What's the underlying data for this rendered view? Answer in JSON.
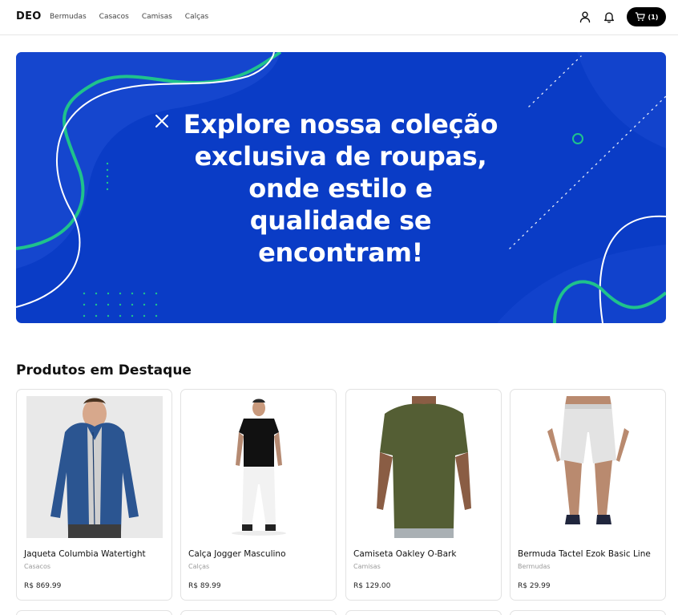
{
  "header": {
    "logo": "DEO",
    "nav": [
      "Bermudas",
      "Casacos",
      "Camisas",
      "Calças"
    ],
    "cart_count": "(1)",
    "icons": [
      "user-icon",
      "bell-icon",
      "cart-icon"
    ]
  },
  "hero": {
    "title": "Explore nossa coleção exclusiva de roupas, onde estilo e qualidade se encontram!",
    "background_color": "#0a3cc6",
    "accent_color": "#1fc28c"
  },
  "featured": {
    "title": "Produtos em Destaque",
    "products": [
      {
        "name": "Jaqueta Columbia Watertight",
        "category": "Casacos",
        "price": "R$ 869.99"
      },
      {
        "name": "Calça Jogger Masculino",
        "category": "Calças",
        "price": "R$ 89.99"
      },
      {
        "name": "Camiseta Oakley O-Bark",
        "category": "Camisas",
        "price": "R$ 129.00"
      },
      {
        "name": "Bermuda Tactel Ezok Basic Line",
        "category": "Bermudas",
        "price": "R$ 29.99"
      }
    ]
  }
}
